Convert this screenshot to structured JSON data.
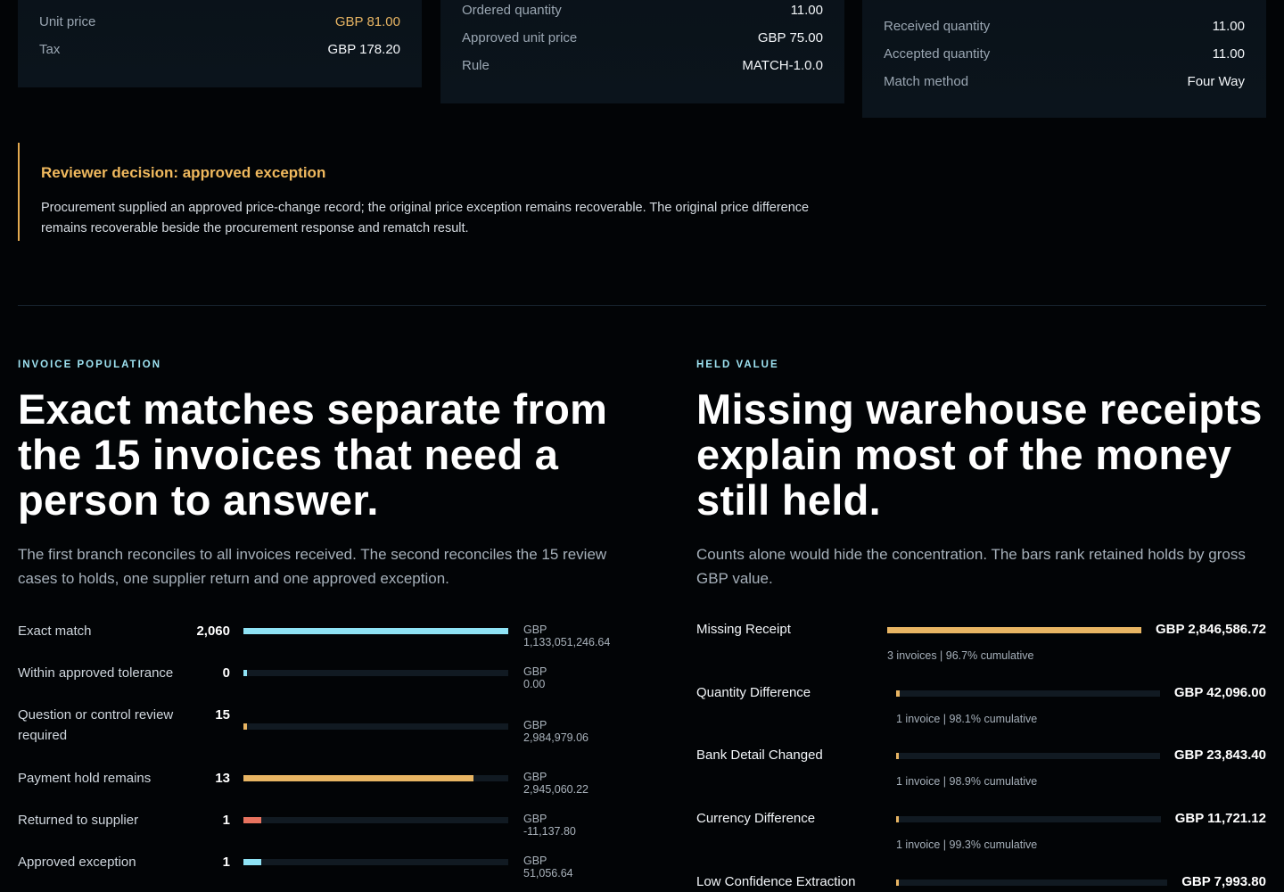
{
  "cards": {
    "invoice": {
      "unit_price_label": "Unit price",
      "unit_price_value": "GBP 81.00",
      "tax_label": "Tax",
      "tax_value": "GBP 178.20"
    },
    "order": {
      "ordered_qty_label": "Ordered quantity",
      "ordered_qty_value": "11.00",
      "approved_price_label": "Approved unit price",
      "approved_price_value": "GBP 75.00",
      "rule_label": "Rule",
      "rule_value": "MATCH-1.0.0"
    },
    "receipt": {
      "received_qty_label": "Received quantity",
      "received_qty_value": "11.00",
      "accepted_qty_label": "Accepted quantity",
      "accepted_qty_value": "11.00",
      "match_method_label": "Match method",
      "match_method_value": "Four Way"
    }
  },
  "decision": {
    "title": "Reviewer decision: approved exception",
    "body": "Procurement supplied an approved price-change record; the original price exception remains recoverable. The original price difference remains recoverable beside the procurement response and rematch result."
  },
  "population": {
    "eyebrow": "INVOICE POPULATION",
    "heading": "Exact matches separate from the 15 invoices that need a person to answer.",
    "lead": "The first branch reconciles to all invoices received. The second reconciles the 15 review cases to holds, one supplier return and one approved exception.",
    "rows": [
      {
        "label": "Exact match",
        "count": "2,060",
        "amount": "GBP 1,133,051,246.64",
        "fraction": 1.0,
        "color": "#8fe3f5"
      },
      {
        "label": "Within approved tolerance",
        "count": "0",
        "amount": "GBP 0.00",
        "fraction": 0.012,
        "color": "#8fe3f5"
      },
      {
        "label": "Question or control review required",
        "count": "15",
        "amount": "GBP 2,984,979.06",
        "fraction": 0.012,
        "color": "#e8b563"
      },
      {
        "label": "Payment hold remains",
        "count": "13",
        "amount": "GBP 2,945,060.22",
        "fraction": 0.87,
        "color": "#e8b563"
      },
      {
        "label": "Returned to supplier",
        "count": "1",
        "amount": "GBP -11,137.80",
        "fraction": 0.067,
        "color": "#e8735f"
      },
      {
        "label": "Approved exception",
        "count": "1",
        "amount": "GBP 51,056.64",
        "fraction": 0.067,
        "color": "#8fe3f5"
      }
    ]
  },
  "held": {
    "eyebrow": "HELD VALUE",
    "heading": "Missing warehouse receipts explain most of the money still held.",
    "lead": "Counts alone would hide the concentration. The bars rank retained holds by gross GBP value.",
    "rows": [
      {
        "label": "Missing Receipt",
        "value": "GBP 2,846,586.72",
        "sub": "3 invoices | 96.7% cumulative",
        "fraction": 1.0
      },
      {
        "label": "Quantity Difference",
        "value": "GBP 42,096.00",
        "sub": "1 invoice | 98.1% cumulative",
        "fraction": 0.015
      },
      {
        "label": "Bank Detail Changed",
        "value": "GBP 23,843.40",
        "sub": "1 invoice | 98.9% cumulative",
        "fraction": 0.008
      },
      {
        "label": "Currency Difference",
        "value": "GBP 11,721.12",
        "sub": "1 invoice | 99.3% cumulative",
        "fraction": 0.004
      },
      {
        "label": "Low Confidence Extraction",
        "value": "GBP 7,993.80",
        "sub": "",
        "fraction": 0.003
      }
    ],
    "bar_color": "#e8b563"
  }
}
